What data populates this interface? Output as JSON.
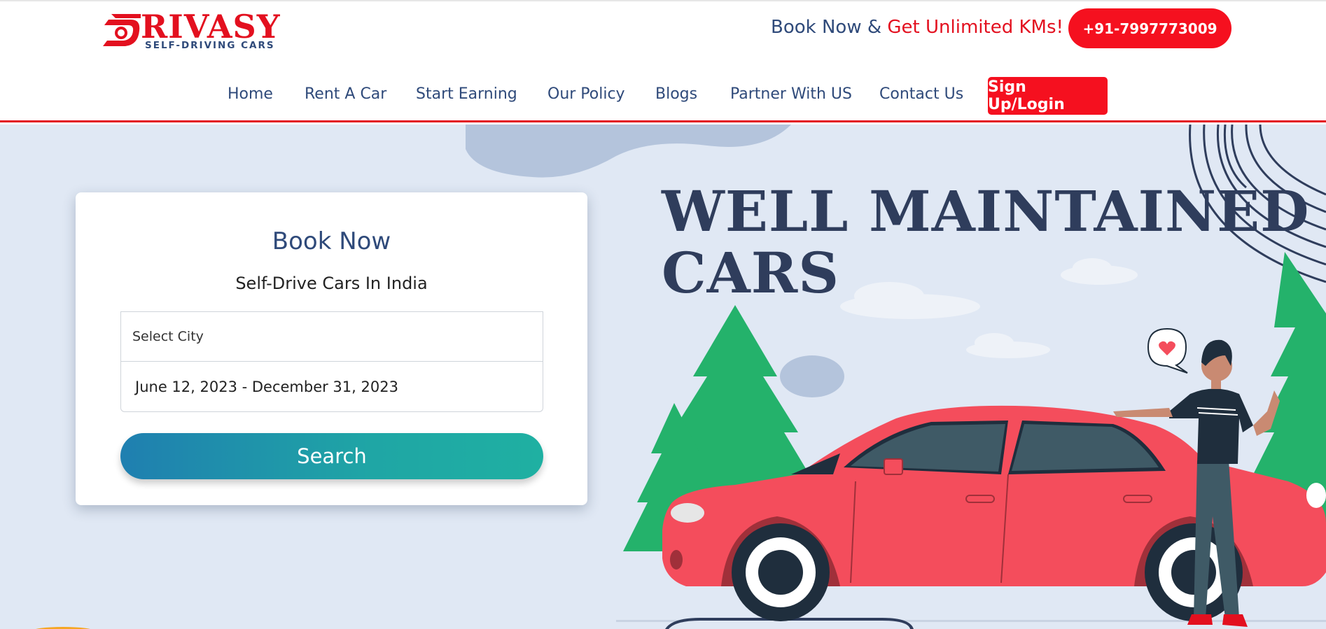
{
  "brand": {
    "name": "RIVASY",
    "tagline": "SELF-DRIVING CARS",
    "color": "#e3101f"
  },
  "header": {
    "promo_prefix": "Book Now & ",
    "promo_highlight": "Get Unlimited KMs!",
    "phone": "+91-7997773009"
  },
  "nav": {
    "items": [
      {
        "label": "Home"
      },
      {
        "label": "Rent A Car"
      },
      {
        "label": "Start Earning"
      },
      {
        "label": "Our Policy"
      },
      {
        "label": "Blogs"
      },
      {
        "label": "Partner With US"
      },
      {
        "label": "Contact Us"
      }
    ],
    "signup_label": "Sign Up/Login"
  },
  "hero": {
    "title_line1": "WELL MAINTAINED",
    "title_line2": "CARS"
  },
  "booking": {
    "title": "Book Now",
    "subtitle": "Self-Drive Cars In India",
    "city_placeholder": "Select City",
    "date_range": "June 12, 2023 - December 31, 2023",
    "search_label": "Search"
  },
  "colors": {
    "navy": "#2f4a7a",
    "red": "#f5101f",
    "hero_bg": "#e0e8f4",
    "car": "#f44d5c",
    "tree": "#24b26b"
  }
}
